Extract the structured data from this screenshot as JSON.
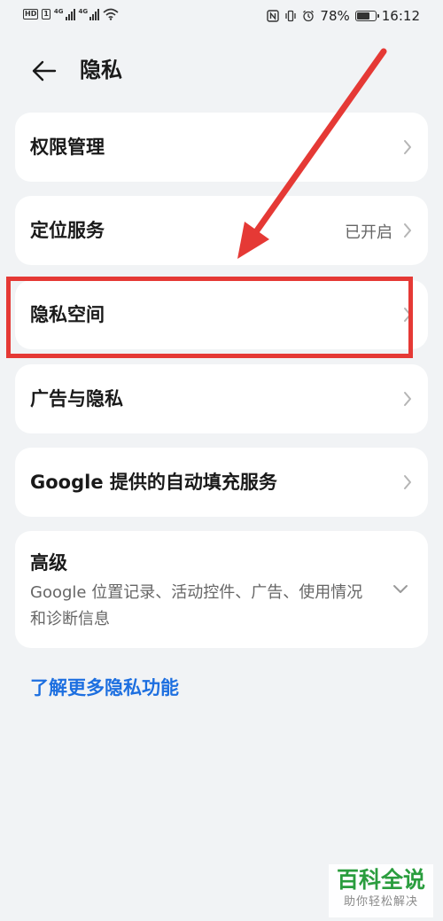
{
  "status_bar": {
    "hd_badge": "HD",
    "sim1_label": "1",
    "net1": "4G",
    "net2": "4G",
    "battery_text": "78%",
    "battery_level": 0.78,
    "time": "16:12"
  },
  "header": {
    "title": "隐私"
  },
  "menu": {
    "permissions": {
      "label": "权限管理"
    },
    "location": {
      "label": "定位服务",
      "value": "已开启"
    },
    "private_space": {
      "label": "隐私空间"
    },
    "ads_privacy": {
      "label": "广告与隐私"
    },
    "google_autofill": {
      "label": "Google 提供的自动填充服务"
    },
    "advanced": {
      "label": "高级",
      "subtitle": "Google 位置记录、活动控件、广告、使用情况和诊断信息"
    }
  },
  "learn_more": "了解更多隐私功能",
  "watermark": {
    "title": "百科全说",
    "subtitle": "助你轻松解决"
  },
  "colors": {
    "background": "#f1f3f5",
    "card": "#ffffff",
    "link": "#1d6fe0",
    "annotation": "#e53935",
    "watermark_green": "#2a9d3e"
  },
  "icons": [
    "wifi-icon",
    "nfc-icon",
    "vibrate-icon",
    "alarm-icon",
    "battery-icon",
    "back-arrow-icon",
    "chevron-right-icon",
    "chevron-down-icon"
  ]
}
